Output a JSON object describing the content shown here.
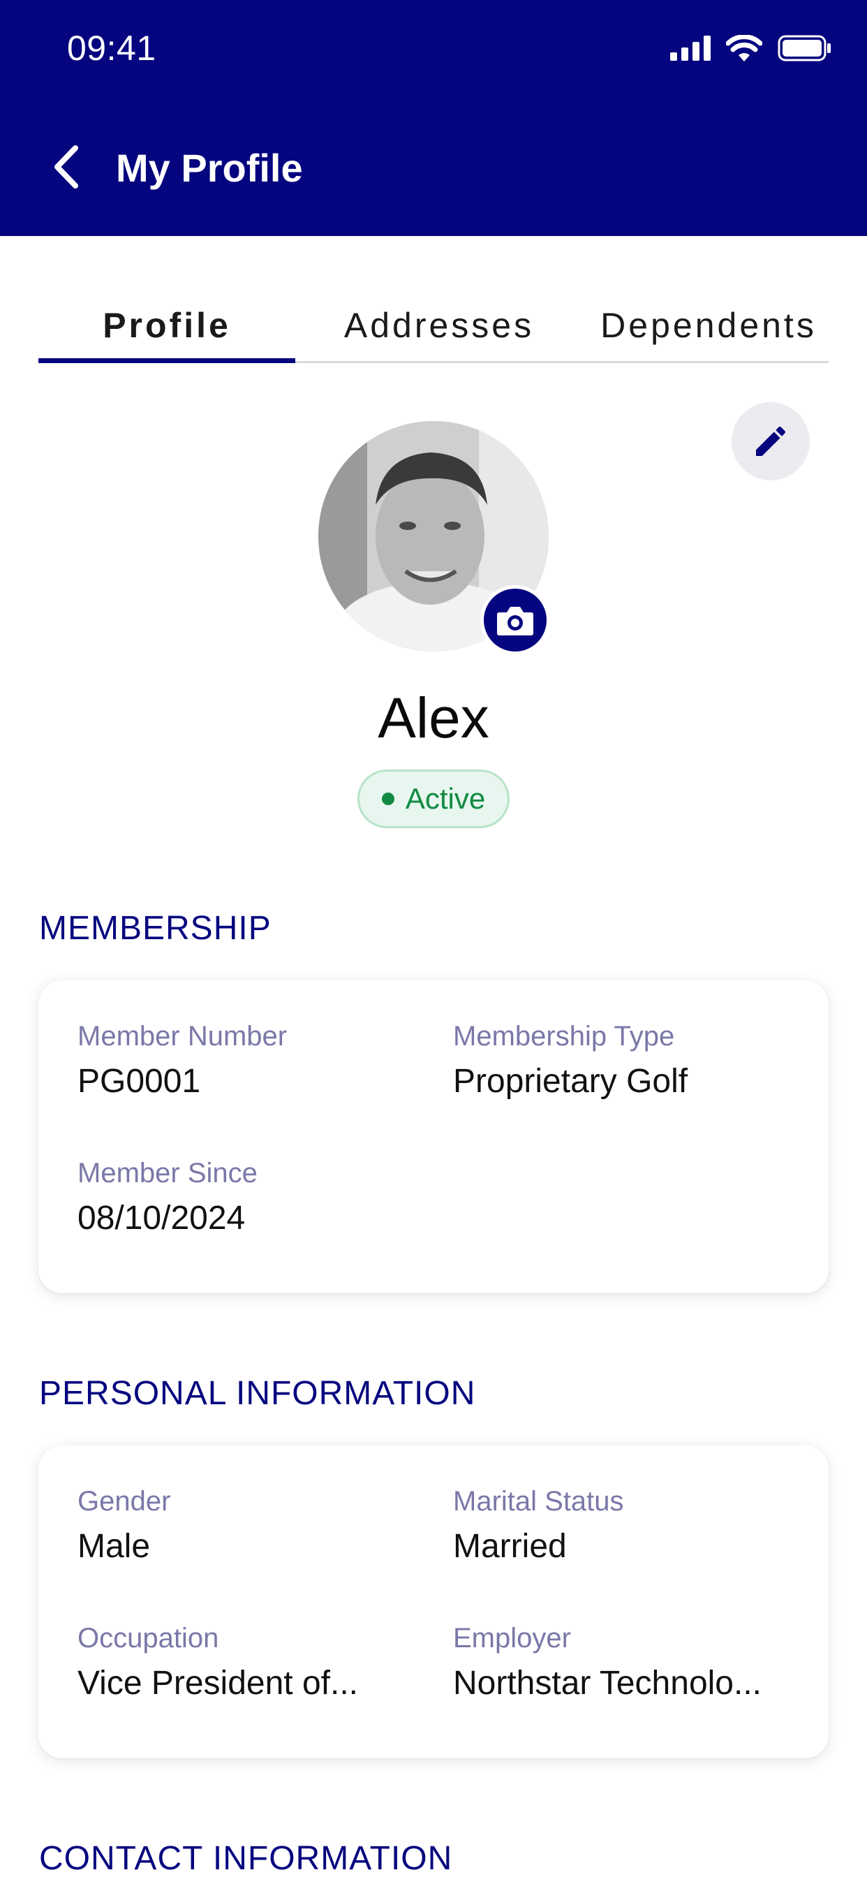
{
  "status_bar": {
    "time": "09:41"
  },
  "header": {
    "title": "My Profile"
  },
  "tabs": [
    {
      "label": "Profile",
      "active": true
    },
    {
      "label": "Addresses",
      "active": false
    },
    {
      "label": "Dependents",
      "active": false
    }
  ],
  "profile": {
    "name": "Alex",
    "status": "Active"
  },
  "membership": {
    "title": "MEMBERSHIP",
    "fields": [
      {
        "label": "Member Number",
        "value": "PG0001"
      },
      {
        "label": "Membership Type",
        "value": "Proprietary Golf"
      },
      {
        "label": "Member Since",
        "value": "08/10/2024"
      }
    ]
  },
  "personal": {
    "title": "PERSONAL INFORMATION",
    "fields": [
      {
        "label": "Gender",
        "value": "Male"
      },
      {
        "label": "Marital Status",
        "value": "Married"
      },
      {
        "label": "Occupation",
        "value": "Vice President of..."
      },
      {
        "label": "Employer",
        "value": "Northstar Technolo..."
      }
    ]
  },
  "contact": {
    "title": "CONTACT INFORMATION"
  },
  "colors": {
    "brand": "#05057f",
    "label": "#7a78a8",
    "active_green": "#118a43",
    "active_bg": "#e7f6ee"
  },
  "icons": [
    "back-chevron-icon",
    "signal-icon",
    "wifi-icon",
    "battery-icon",
    "edit-pencil-icon",
    "camera-icon"
  ]
}
